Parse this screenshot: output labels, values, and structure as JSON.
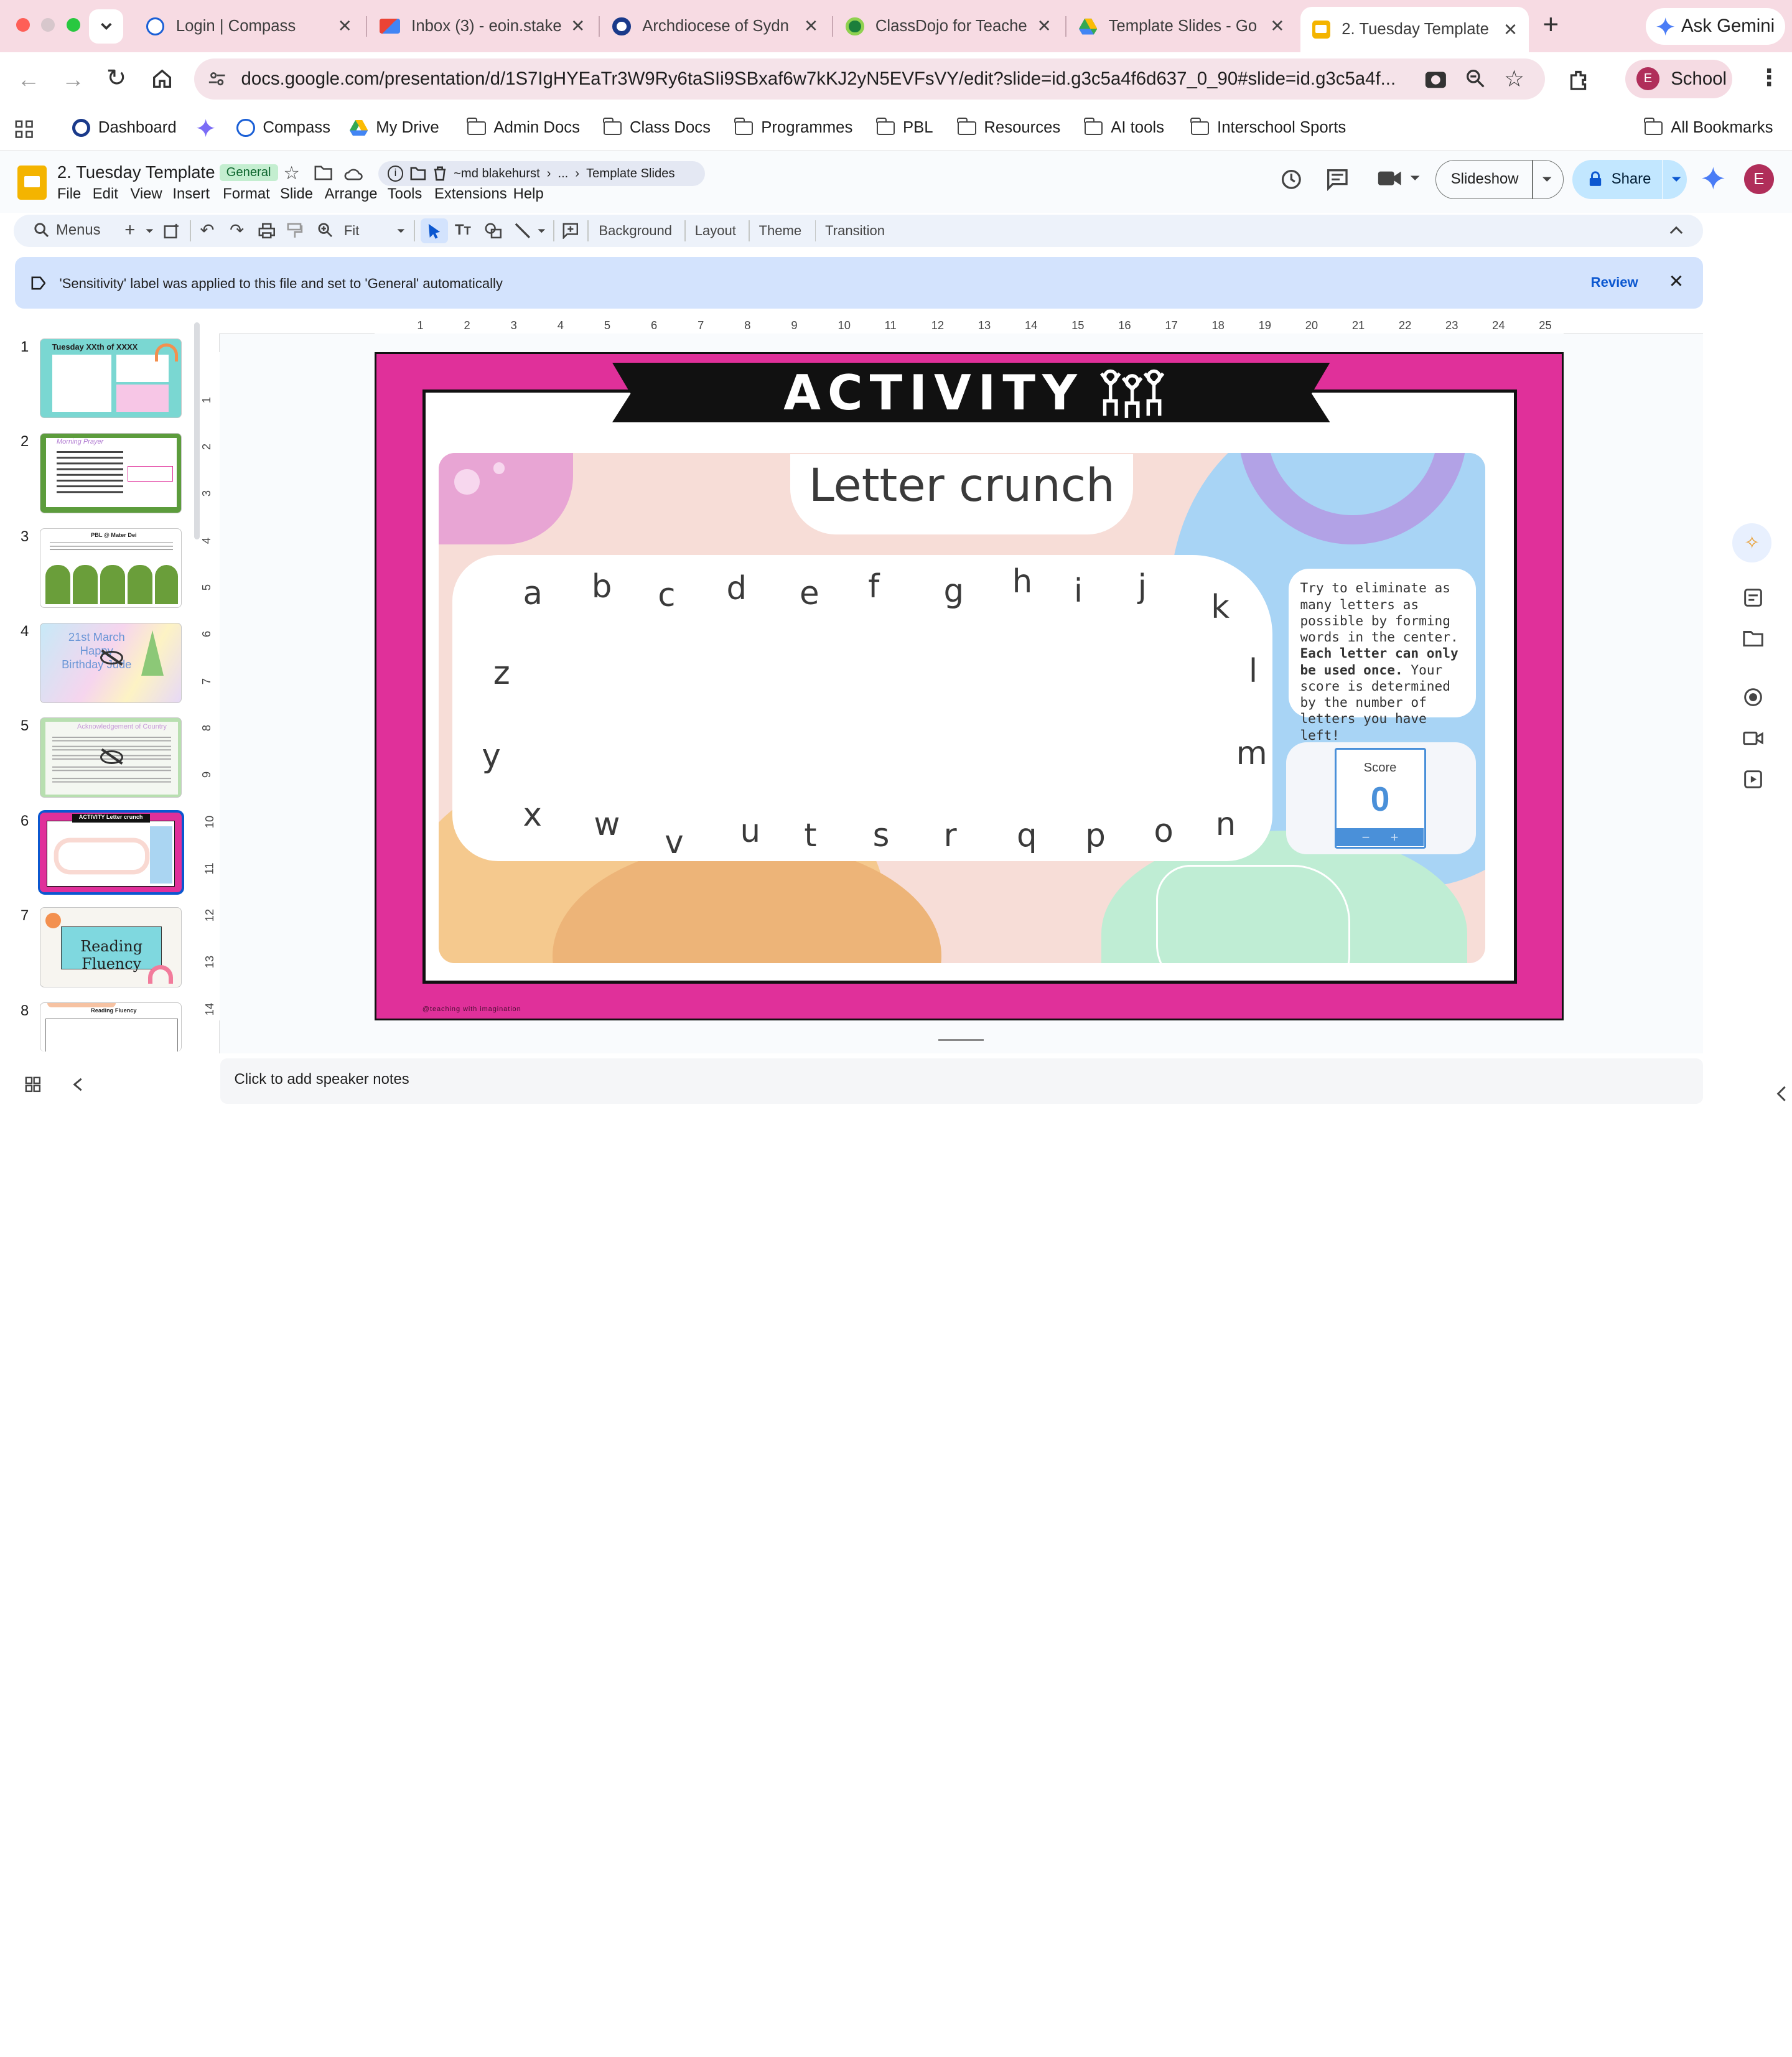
{
  "browser": {
    "tabs": [
      {
        "title": "Login | Compass",
        "favicon_color": "#1a5fd6"
      },
      {
        "title": "Inbox (3) - eoin.stake",
        "favicon_color": "#ea4335"
      },
      {
        "title": "Archdiocese of Sydn",
        "favicon_color": "#1a3a8a"
      },
      {
        "title": "ClassDojo for Teache",
        "favicon_color": "#1b7f3b"
      },
      {
        "title": "Template Slides - Go",
        "favicon_color": "#34a853"
      },
      {
        "title": "2. Tuesday Template",
        "favicon_color": "#f4b400"
      }
    ],
    "new_tab": "+",
    "ask_gemini": "Ask Gemini",
    "url": "docs.google.com/presentation/d/1S7IgHYEaTr3W9Ry6taSIi9SBxaf6w7kKJ2yN5EVFsVY/edit?slide=id.g3c5a4f6d637_0_90#slide=id.g3c5a4f...",
    "profile_initial": "E",
    "profile_label": "School",
    "bookmarks": [
      "Dashboard",
      "Compass",
      "My Drive",
      "Admin Docs",
      "Class Docs",
      "Programmes",
      "PBL",
      "Resources",
      "AI tools",
      "Interschool Sports"
    ],
    "all_bookmarks": "All Bookmarks"
  },
  "doc": {
    "title": "2. Tuesday Template",
    "label": "General",
    "breadcrumb": [
      "~md blakehurst",
      "...",
      "Template Slides"
    ],
    "menus": [
      "File",
      "Edit",
      "View",
      "Insert",
      "Format",
      "Slide",
      "Arrange",
      "Tools",
      "Extensions",
      "Help"
    ],
    "slideshow": "Slideshow",
    "share": "Share",
    "user_initial": "E"
  },
  "toolbar": {
    "search": "Menus",
    "zoom": "Fit",
    "buttons": [
      "Background",
      "Layout",
      "Theme",
      "Transition"
    ]
  },
  "banner": {
    "text": "'Sensitivity' label was applied to this file and set to 'General' automatically",
    "action": "Review"
  },
  "rulers": {
    "h": [
      "1",
      "2",
      "3",
      "4",
      "5",
      "6",
      "7",
      "8",
      "9",
      "10",
      "11",
      "12",
      "13",
      "14",
      "15",
      "16",
      "17",
      "18",
      "19",
      "20",
      "21",
      "22",
      "23",
      "24",
      "25"
    ],
    "v": [
      "1",
      "2",
      "3",
      "4",
      "5",
      "6",
      "7",
      "8",
      "9",
      "10",
      "11",
      "12",
      "13",
      "14"
    ]
  },
  "filmstrip": [
    {
      "num": "1",
      "title": "Tuesday XXth of XXXX"
    },
    {
      "num": "2",
      "title": "Morning Prayer"
    },
    {
      "num": "3",
      "title": "PBL @ Mater Dei"
    },
    {
      "num": "4",
      "title": "21st March Happy Birthday Jude"
    },
    {
      "num": "5",
      "title": "Acknowledgement of Country"
    },
    {
      "num": "6",
      "title": "ACTIVITY Letter crunch"
    },
    {
      "num": "7",
      "title": "Reading Fluency"
    },
    {
      "num": "8",
      "title": "Reading Fluency"
    }
  ],
  "slide": {
    "header": "ACTIVITY",
    "title": "Letter crunch",
    "letters": [
      "a",
      "b",
      "c",
      "d",
      "e",
      "f",
      "g",
      "h",
      "i",
      "j",
      "k",
      "l",
      "m",
      "n",
      "o",
      "p",
      "q",
      "r",
      "s",
      "t",
      "u",
      "v",
      "w",
      "x",
      "y",
      "z"
    ],
    "instructions_part1": "Try to eliminate as many letters as possible by forming words in the center.",
    "instructions_bold": "Each letter can only be used once.",
    "instructions_part2": "Your score is determined by the number of letters you have left!",
    "score_label": "Score",
    "score_value": "0",
    "score_minus": "−",
    "score_plus": "+",
    "credit": "@teaching with imagination"
  },
  "speaker_notes": "Click to add speaker notes"
}
